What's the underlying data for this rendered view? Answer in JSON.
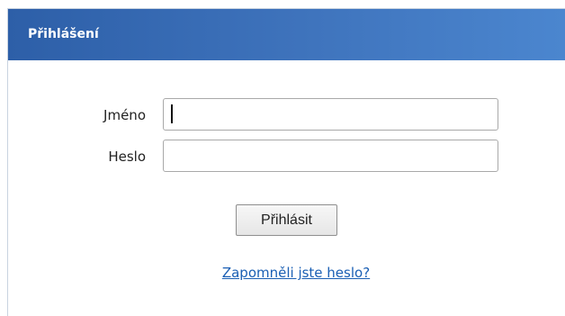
{
  "login_panel": {
    "title": "Přihlášení",
    "name_label": "Jméno",
    "name_value": "",
    "password_label": "Heslo",
    "password_value": "",
    "submit_label": "Přihlásit",
    "forgot_link": "Zapomněli jste heslo?"
  },
  "colors": {
    "header_start": "#2d5fa8",
    "header_end": "#4b86cf",
    "link": "#1a5fb4"
  }
}
